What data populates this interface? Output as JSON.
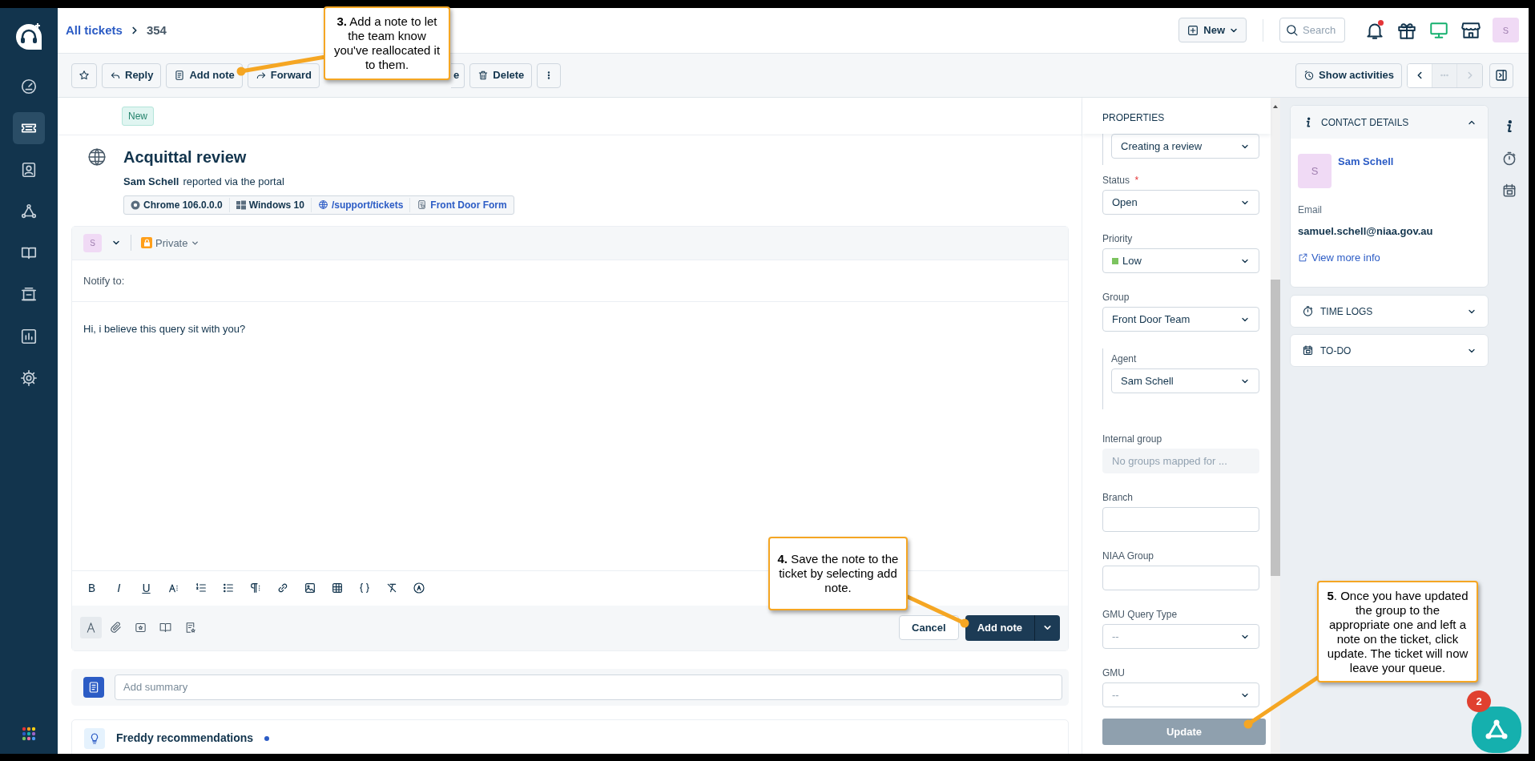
{
  "sidebar": {
    "items": [
      {
        "selected": false
      },
      {
        "selected": true
      },
      {
        "selected": false
      },
      {
        "selected": false
      },
      {
        "selected": false
      },
      {
        "selected": false
      },
      {
        "selected": false
      },
      {
        "selected": false
      }
    ]
  },
  "topbar": {
    "breadcrumb": [
      {
        "kind": "link",
        "label": "All tickets"
      },
      {
        "kind": "current",
        "label": "354"
      }
    ],
    "new_button": "New",
    "search_placeholder": "Search",
    "notifications_unread": true,
    "avatar": "S"
  },
  "toolbar": {
    "buttons": [
      {
        "kind": "star"
      },
      {
        "kind": "reply",
        "label": "Reply"
      },
      {
        "kind": "note",
        "label": "Add note"
      },
      {
        "kind": "forward",
        "label": "Forward"
      },
      {
        "kind": "covered",
        "label": "e"
      },
      {
        "kind": "delete",
        "label": "Delete"
      },
      {
        "kind": "more"
      }
    ],
    "activities": "Show activities",
    "nav": [
      {
        "kind": "prev",
        "disabled": false
      },
      {
        "kind": "more",
        "disabled": true
      },
      {
        "kind": "next",
        "disabled": true
      }
    ]
  },
  "ticket": {
    "status_tag": "New",
    "title": "Acquittal review",
    "requester": "Sam Schell",
    "via": "reported via the portal",
    "meta": [
      {
        "kind": "browser",
        "label": "Chrome 106.0.0.0"
      },
      {
        "kind": "os",
        "label": "Windows 10"
      },
      {
        "kind": "url",
        "label": "/support/tickets"
      },
      {
        "kind": "form",
        "label": "Front Door Form"
      }
    ]
  },
  "editor": {
    "avatar": "S",
    "visibility": "Private",
    "notify_label": "Notify to:",
    "body": "Hi, i believe this query sit with you?",
    "format_letters": [
      "B",
      "I",
      "U"
    ],
    "cancel": "Cancel",
    "submit": "Add note"
  },
  "summary": {
    "placeholder": "Add summary"
  },
  "freddy": {
    "title": "Freddy recommendations",
    "dot": true
  },
  "properties": {
    "title": "PROPERTIES",
    "fields": [
      {
        "kind": "select",
        "value": "Creating a review",
        "nested": true
      },
      {
        "kind": "select",
        "label": "Status",
        "required_mark": "*",
        "value": "Open",
        "nested": false
      },
      {
        "kind": "select",
        "label": "Priority",
        "value": "Low",
        "color": "#7cc35f",
        "nested": false
      },
      {
        "kind": "select",
        "label": "Group",
        "value": "Front Door Team",
        "nested": false
      },
      {
        "kind": "select",
        "label": "Agent",
        "value": "Sam Schell",
        "nested": true
      },
      {
        "kind": "disabled",
        "label": "Internal group",
        "value": "No groups mapped for ...",
        "nested": false
      },
      {
        "kind": "input",
        "label": "Branch",
        "nested": false
      },
      {
        "kind": "input",
        "label": "NIAA Group",
        "nested": false
      },
      {
        "kind": "select",
        "label": "GMU Query Type",
        "placeholder": "--",
        "nested": false
      },
      {
        "kind": "select",
        "label": "GMU",
        "placeholder": "--",
        "nested": false
      }
    ],
    "update": "Update",
    "update_disabled": true
  },
  "contact": {
    "title": "CONTACT DETAILS",
    "expanded": true,
    "avatar": "S",
    "name": "Sam Schell",
    "email_label": "Email",
    "email": "samuel.schell@niaa.gov.au",
    "more_link": "View more info"
  },
  "panels": [
    {
      "kind": "timer",
      "title": "TIME LOGS",
      "expanded": false
    },
    {
      "kind": "todo",
      "title": "TO-DO",
      "expanded": false
    }
  ],
  "callouts": [
    {
      "text": "**3.** Add a note to let the team know you've reallocated it to them."
    },
    {
      "text": "**4.** Save the note to the ticket by selecting add note."
    },
    {
      "text": "**5**. Once you have updated the group to the appropriate one and left a note on the ticket, click update. The ticket will now leave your queue."
    }
  ],
  "widget": {
    "badge": "2"
  }
}
